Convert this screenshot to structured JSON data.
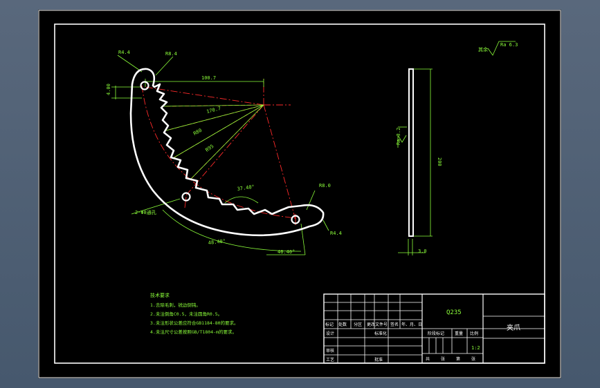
{
  "notes": {
    "title": "技术要求",
    "lines": [
      "1.去除毛刺，锐边倒钝。",
      "2.未注倒角C0.5，未注圆角R0.5。",
      "3.未注形状公差应符合GB1184-80的要求。",
      "4.未注尺寸公差按照GB/T1804-m的要求。"
    ]
  },
  "dimensions": {
    "r_top_left": "R4.4",
    "r_top_right": "R8.4",
    "dim_horizontal": "100.7",
    "dim_left_vertical": "4.00",
    "dim_r1": "170.7",
    "dim_r2": "R80",
    "dim_r3": "R95",
    "angle_small": "37.40°",
    "r_right_top": "R8.0",
    "r_right_bottom": "R4.4",
    "holes": "2-Φ8通孔",
    "angle_arc_left": "48.40°",
    "angle_arc_right": "46.40°"
  },
  "side_view": {
    "thickness": "3.0",
    "length": "200",
    "roughness": "Ra 3.2"
  },
  "roughness_note": {
    "label": "其余",
    "value": "Ra 6.3"
  },
  "title_block": {
    "material": "Q235",
    "part_name": "夹爪",
    "scale": "1:2",
    "headers": [
      "标记",
      "处数",
      "分区",
      "更改文件号",
      "签名",
      "年、月、日"
    ],
    "design": "设计",
    "standardization": "标准化",
    "review": "审核",
    "process": "工艺",
    "approve": "批准",
    "stage_mark": "阶段标记",
    "weight": "重量",
    "scale_label": "比例",
    "sheets": [
      "共",
      "张",
      "第",
      "张"
    ]
  },
  "colors": {
    "background": "#000000",
    "outline": "#ffffff",
    "dimension": "#8cff3a",
    "centerline": "#ff2a2a"
  }
}
